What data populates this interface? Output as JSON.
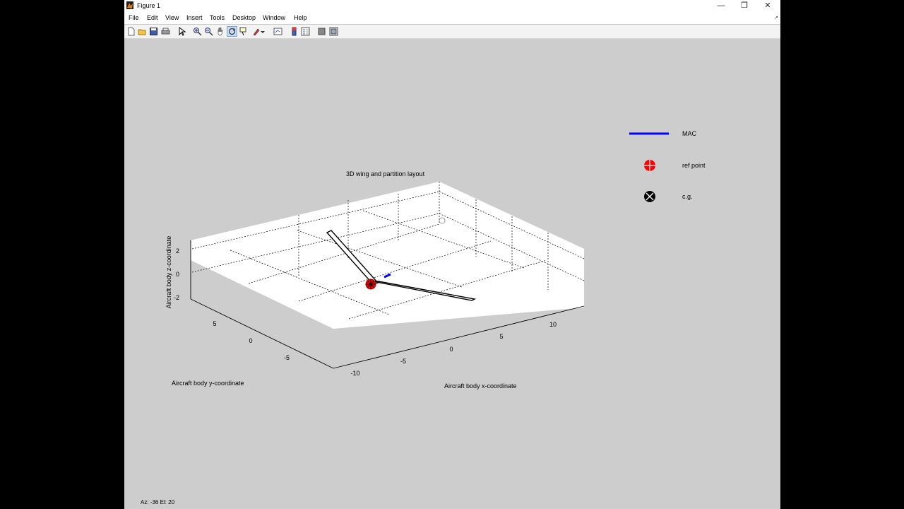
{
  "window": {
    "title": "Figure 1",
    "controls": {
      "minimize": "—",
      "maximize": "❐",
      "close": "✕"
    }
  },
  "menubar": {
    "items": [
      "File",
      "Edit",
      "View",
      "Insert",
      "Tools",
      "Desktop",
      "Window",
      "Help"
    ],
    "overflow_icon": "↗"
  },
  "toolbar": {
    "tools": [
      "new-figure",
      "open-file",
      "save-figure",
      "print-figure",
      "edit-plot-pointer",
      "zoom-in",
      "zoom-out",
      "pan",
      "rotate-3d",
      "data-cursor",
      "brush",
      "link-plot",
      "insert-colorbar",
      "insert-legend",
      "hide-plot-tools",
      "show-plot-tools"
    ]
  },
  "plot": {
    "title": "3D wing and partition layout",
    "xlabel": "Aircraft body x-coordinate",
    "ylabel": "Aircraft body y-coordinate",
    "zlabel": "Aircraft body z-coordinate",
    "x_ticks": [
      "-10",
      "-5",
      "0",
      "5",
      "10"
    ],
    "y_ticks": [
      "5",
      "0",
      "-5"
    ],
    "z_ticks": [
      "2",
      "0",
      "-2"
    ]
  },
  "legend": {
    "items": [
      {
        "label": "MAC",
        "symbol": "line",
        "color": "#0000ff"
      },
      {
        "label": "ref point",
        "symbol": "circle-plus",
        "color": "#ff0000"
      },
      {
        "label": "c.g.",
        "symbol": "circle-x",
        "color": "#000000"
      }
    ]
  },
  "status": {
    "view_angles": "Az: -36 El:  20"
  },
  "colors": {
    "figure_bg": "#cdcdcd",
    "axes_bg": "#ffffff",
    "mac": "#0000ff",
    "ref_point": "#ff0000",
    "cg": "#000000"
  }
}
